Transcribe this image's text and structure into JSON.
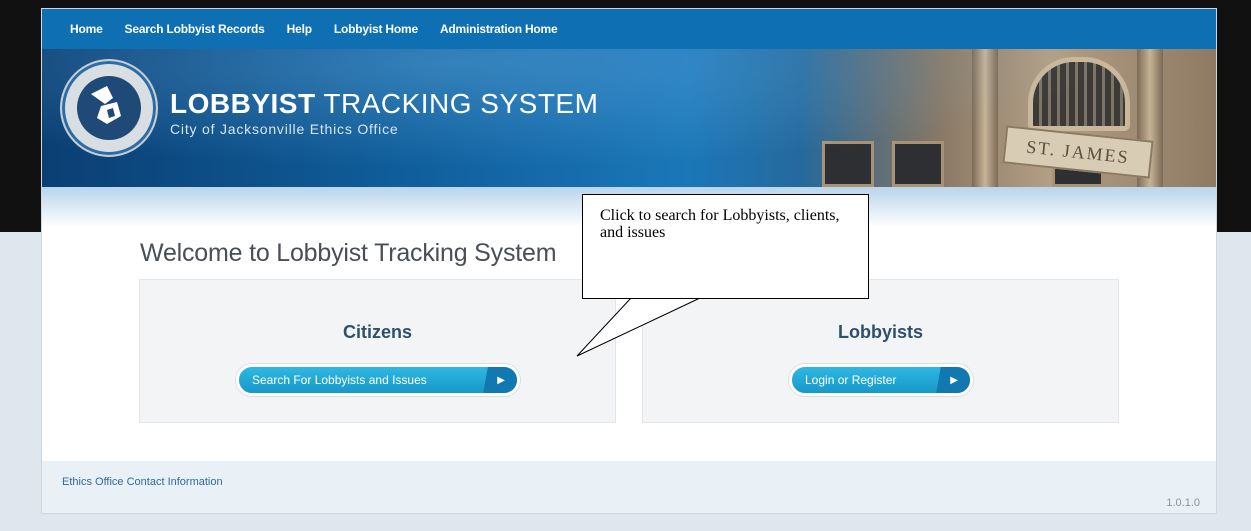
{
  "nav": {
    "items": [
      "Home",
      "Search Lobbyist Records",
      "Help",
      "Lobbyist Home",
      "Administration Home"
    ]
  },
  "header": {
    "title_bold": "LOBBYIST",
    "title_rest": "TRACKING SYSTEM",
    "subtitle": "City of Jacksonville Ethics Office",
    "seal_icon": "city-seal-icon",
    "banner_sign": "ST. JAMES"
  },
  "main": {
    "welcome": "Welcome to Lobbyist Tracking System",
    "citizens": {
      "title": "Citizens",
      "button_label": "Search For Lobbyists and Issues"
    },
    "lobbyists": {
      "title": "Lobbyists",
      "button_label": "Login or Register"
    }
  },
  "callout": {
    "text": "Click to search for Lobbyists, clients, and issues"
  },
  "footer": {
    "contact_link": "Ethics Office Contact Information",
    "version": "1.0.1.0"
  },
  "colors": {
    "nav_bg": "#0e6fb3",
    "button": "#1fa8d6",
    "panel_title": "#2f4f6f"
  }
}
